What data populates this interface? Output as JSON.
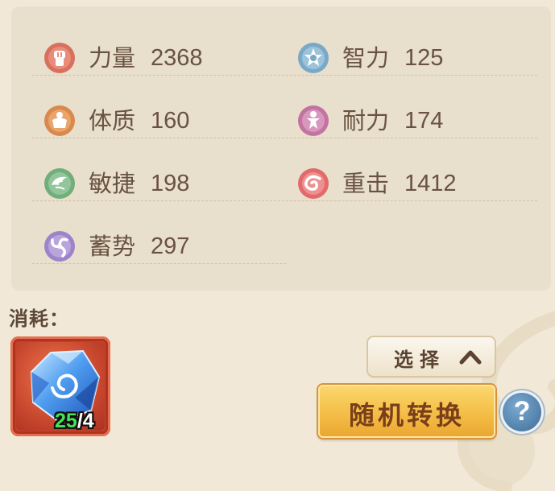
{
  "stats": [
    {
      "id": "strength",
      "name": "力量",
      "value": "2368",
      "icon": "fist-icon",
      "color": "#d8705e"
    },
    {
      "id": "intellect",
      "name": "智力",
      "value": "125",
      "icon": "star-emblem-icon",
      "color": "#78a9c7"
    },
    {
      "id": "constitution",
      "name": "体质",
      "value": "160",
      "icon": "body-icon",
      "color": "#d8894d"
    },
    {
      "id": "endurance",
      "name": "耐力",
      "value": "174",
      "icon": "figure-icon",
      "color": "#c373a1"
    },
    {
      "id": "agility",
      "name": "敏捷",
      "value": "198",
      "icon": "wing-icon",
      "color": "#72ad7c"
    },
    {
      "id": "heavy_strike",
      "name": "重击",
      "value": "1412",
      "icon": "swirl-icon",
      "color": "#e26a6a"
    },
    {
      "id": "charge",
      "name": "蓄势",
      "value": "297",
      "icon": "spiral-icon",
      "color": "#9d83c9"
    }
  ],
  "consume": {
    "label": "消耗：",
    "item": {
      "icon": "blue-crystal-icon",
      "have": "25",
      "separator": "/",
      "need": "4"
    }
  },
  "buttons": {
    "select_label": "选择",
    "random_convert_label": "随机转换",
    "help_label": "?"
  },
  "colors": {
    "background": "#f1e8d7",
    "panel": "#e9dfcd",
    "text": "#6a5240",
    "count_have": "#48e25a",
    "random_button": "#f5c04a",
    "help_button": "#3d6e99"
  }
}
